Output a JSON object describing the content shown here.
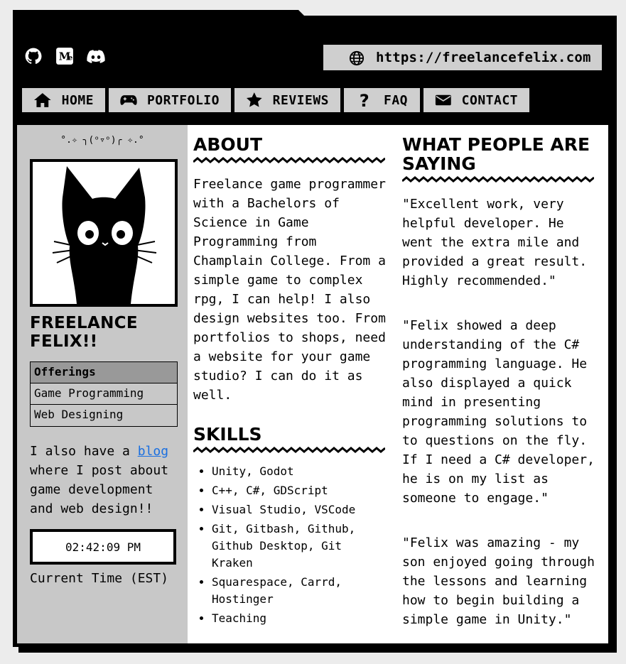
{
  "window": {
    "url": "https://freelancefelix.com"
  },
  "topbar": {
    "icons": [
      "github-icon",
      "medium-icon",
      "discord-icon"
    ]
  },
  "nav": [
    {
      "label": "HOME",
      "icon": "home-icon"
    },
    {
      "label": "PORTFOLIO",
      "icon": "gamepad-icon"
    },
    {
      "label": "REVIEWS",
      "icon": "star-icon"
    },
    {
      "label": "FAQ",
      "icon": "question-icon"
    },
    {
      "label": "CONTACT",
      "icon": "envelope-icon"
    }
  ],
  "sidebar": {
    "kaomoji": "°.✧ ╮(ᵒ▿ᵒ)╭ ✧.°",
    "name_line1": "FREELANCE",
    "name_line2": "FELIX!!",
    "offerings_header": "Offerings",
    "offerings": [
      "Game Programming",
      "Web Designing"
    ],
    "blog_prefix": "I also have a ",
    "blog_link": "blog",
    "blog_suffix": " where I post about game development and web design!!",
    "clock_time": "02:42:09 PM",
    "clock_label": "Current Time (EST)"
  },
  "about": {
    "title": "ABOUT",
    "text": "Freelance game programmer with a Bachelors of Science in Game Programming from Champlain College. From a simple game to complex rpg, I can help! I also design websites too. From portfolios to shops, need a website for your game studio? I can do it as well."
  },
  "skills": {
    "title": "SKILLS",
    "items": [
      "Unity, Godot",
      "C++, C#, GDScript",
      "Visual Studio, VSCode",
      "Git, Gitbash, Github, Github Desktop, Git Kraken",
      "Squarespace, Carrd, Hostinger",
      "Teaching"
    ]
  },
  "reviews": {
    "title": "WHAT PEOPLE ARE SAYING",
    "items": [
      "\"Excellent work, very helpful developer. He went the extra mile and provided a great result. Highly recommended.\"",
      "\"Felix showed a deep understanding of the C# programming language. He also displayed a quick mind in presenting programming solutions to to questions on the fly. If I need a C# developer, he is on my list as someone to engage.\"",
      "\"Felix was amazing - my son enjoyed going through the lessons and learning how to begin building a simple game in Unity.\""
    ]
  },
  "colors": {
    "frame": "#000000",
    "sidebar_bg": "#c8c8c8",
    "button_bg": "#cfcfcf",
    "link": "#1a6fe0",
    "page_bg": "#ececec"
  }
}
